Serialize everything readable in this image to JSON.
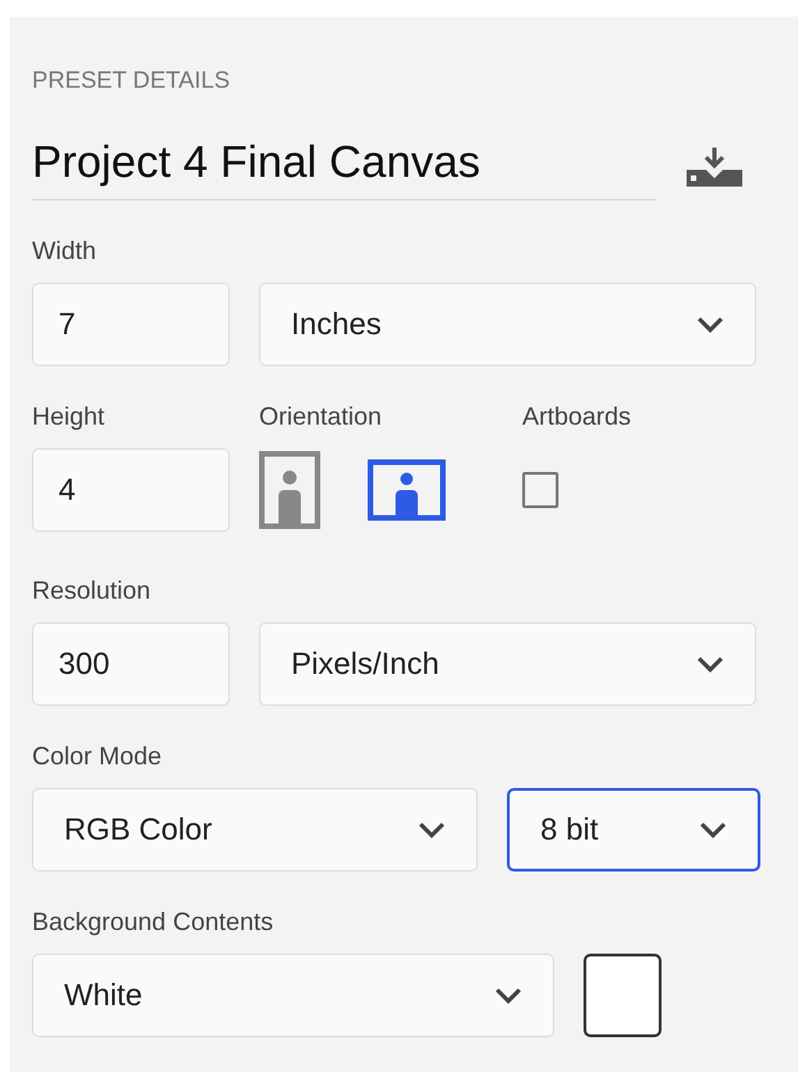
{
  "section_title": "PRESET DETAILS",
  "preset_name": "Project 4 Final Canvas",
  "width": {
    "label": "Width",
    "value": "7",
    "unit": {
      "value": "Inches",
      "focused": false
    }
  },
  "height": {
    "label": "Height",
    "value": "4"
  },
  "orientation": {
    "label": "Orientation",
    "options": [
      {
        "kind": "portrait",
        "selected": false
      },
      {
        "kind": "landscape",
        "selected": true
      }
    ]
  },
  "artboards": {
    "label": "Artboards",
    "checked": false
  },
  "resolution": {
    "label": "Resolution",
    "value": "300",
    "unit": {
      "value": "Pixels/Inch",
      "focused": false
    }
  },
  "color_mode": {
    "label": "Color Mode",
    "mode": {
      "value": "RGB Color",
      "focused": false
    },
    "depth": {
      "value": "8 bit",
      "focused": true
    }
  },
  "background_contents": {
    "label": "Background Contents",
    "value": {
      "value": "White",
      "focused": false
    },
    "color": "#ffffff"
  }
}
